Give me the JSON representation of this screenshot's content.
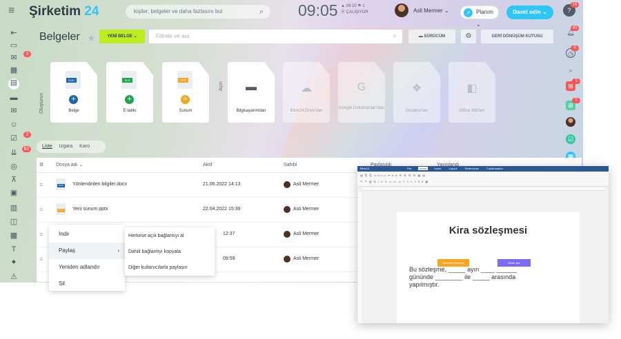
{
  "header": {
    "logo_main": "Şirketim",
    "logo_accent": "24",
    "search_placeholder": "kişiler, belgeler ve daha fazlasını bul",
    "clock": "09:05",
    "clock_sub_time": "09:10",
    "clock_sub_count": "1",
    "clock_status": "ÇALIŞIYOR",
    "user_name": "Asli Mermer",
    "plan_label": "Planım",
    "invite_label": "Davet edin",
    "help": "?"
  },
  "left_sidebar": {
    "badges": [
      "2",
      "2",
      "82"
    ]
  },
  "right_sidebar": {
    "badges": [
      "16",
      "40",
      "6",
      "1",
      "1"
    ]
  },
  "toolbar": {
    "page_title": "Belgeler",
    "new_doc": "YENİ BELGE",
    "filter_placeholder": "Filtrele ve ara",
    "drive": "SÜRÜCÜM",
    "recycle": "GERİ DÖNÜŞÜM KUTUSU"
  },
  "create_label": "Oluşturun",
  "open_label": "Açın",
  "create_cards": [
    {
      "tag": "DOC",
      "label": "Belge",
      "color": "#2067b0"
    },
    {
      "tag": "XLS",
      "label": "E-tablo",
      "color": "#1ea64b"
    },
    {
      "tag": "PPT",
      "label": "Sunum",
      "color": "#f5a623"
    }
  ],
  "open_cards": [
    {
      "label": "Bilgisayarımdan"
    },
    {
      "label": "Bitrix24.Drive'dan"
    },
    {
      "label": "Google Dokümanları'dan"
    },
    {
      "label": "Dropbox'tan"
    },
    {
      "label": "Office 365'ten"
    }
  ],
  "views": [
    "Liste",
    "Izgara",
    "Karo"
  ],
  "table": {
    "headers": [
      "Dosya adı ⌄",
      "Aktif",
      "Sahibi",
      "Paylaşıldı",
      "Yayınlandı"
    ],
    "rows": [
      {
        "tag": "DOC",
        "tag_color": "#2067b0",
        "name": "Yönlendirilen bilgiler.docx",
        "date": "21.06.2022 14:13",
        "owner": "Asli Mermer"
      },
      {
        "tag": "PPT",
        "tag_color": "#f5a623",
        "name": "Yeni sunum.pptx",
        "date": "22.04.2022 15:39",
        "owner": "Asli Mermer"
      },
      {
        "tag": "",
        "tag_color": "#2067b0",
        "name": "",
        "date": "12:37",
        "owner": "Asli Mermer"
      },
      {
        "tag": "",
        "tag_color": "#2067b0",
        "name": "",
        "date": "09:59",
        "owner": "Asli Mermer"
      }
    ]
  },
  "context_menu": {
    "items": [
      "İndir",
      "Paylaş",
      "Yeniden adlandır",
      "Sil"
    ],
    "submenu": [
      "Herkese açık bağlantıyı al",
      "Dahili bağlantıyı kopyala",
      "Diğer kullanıcılarla paylaşın"
    ]
  },
  "editor": {
    "app": "Bitrix24",
    "tabs": [
      "File",
      "Home",
      "Insert",
      "Layout",
      "References",
      "Collaboration"
    ],
    "heading": "Kira sözleşmesi",
    "line1_a": "Bu sözleşme,",
    "line1_b": "ayın",
    "line2_a": "gününde",
    "line2_b": "ile",
    "line2_c": "arasında",
    "line3": "yapılmıştır.",
    "cursor1": "Mehmet Pehlivan",
    "cursor2": "Selim Işık"
  }
}
